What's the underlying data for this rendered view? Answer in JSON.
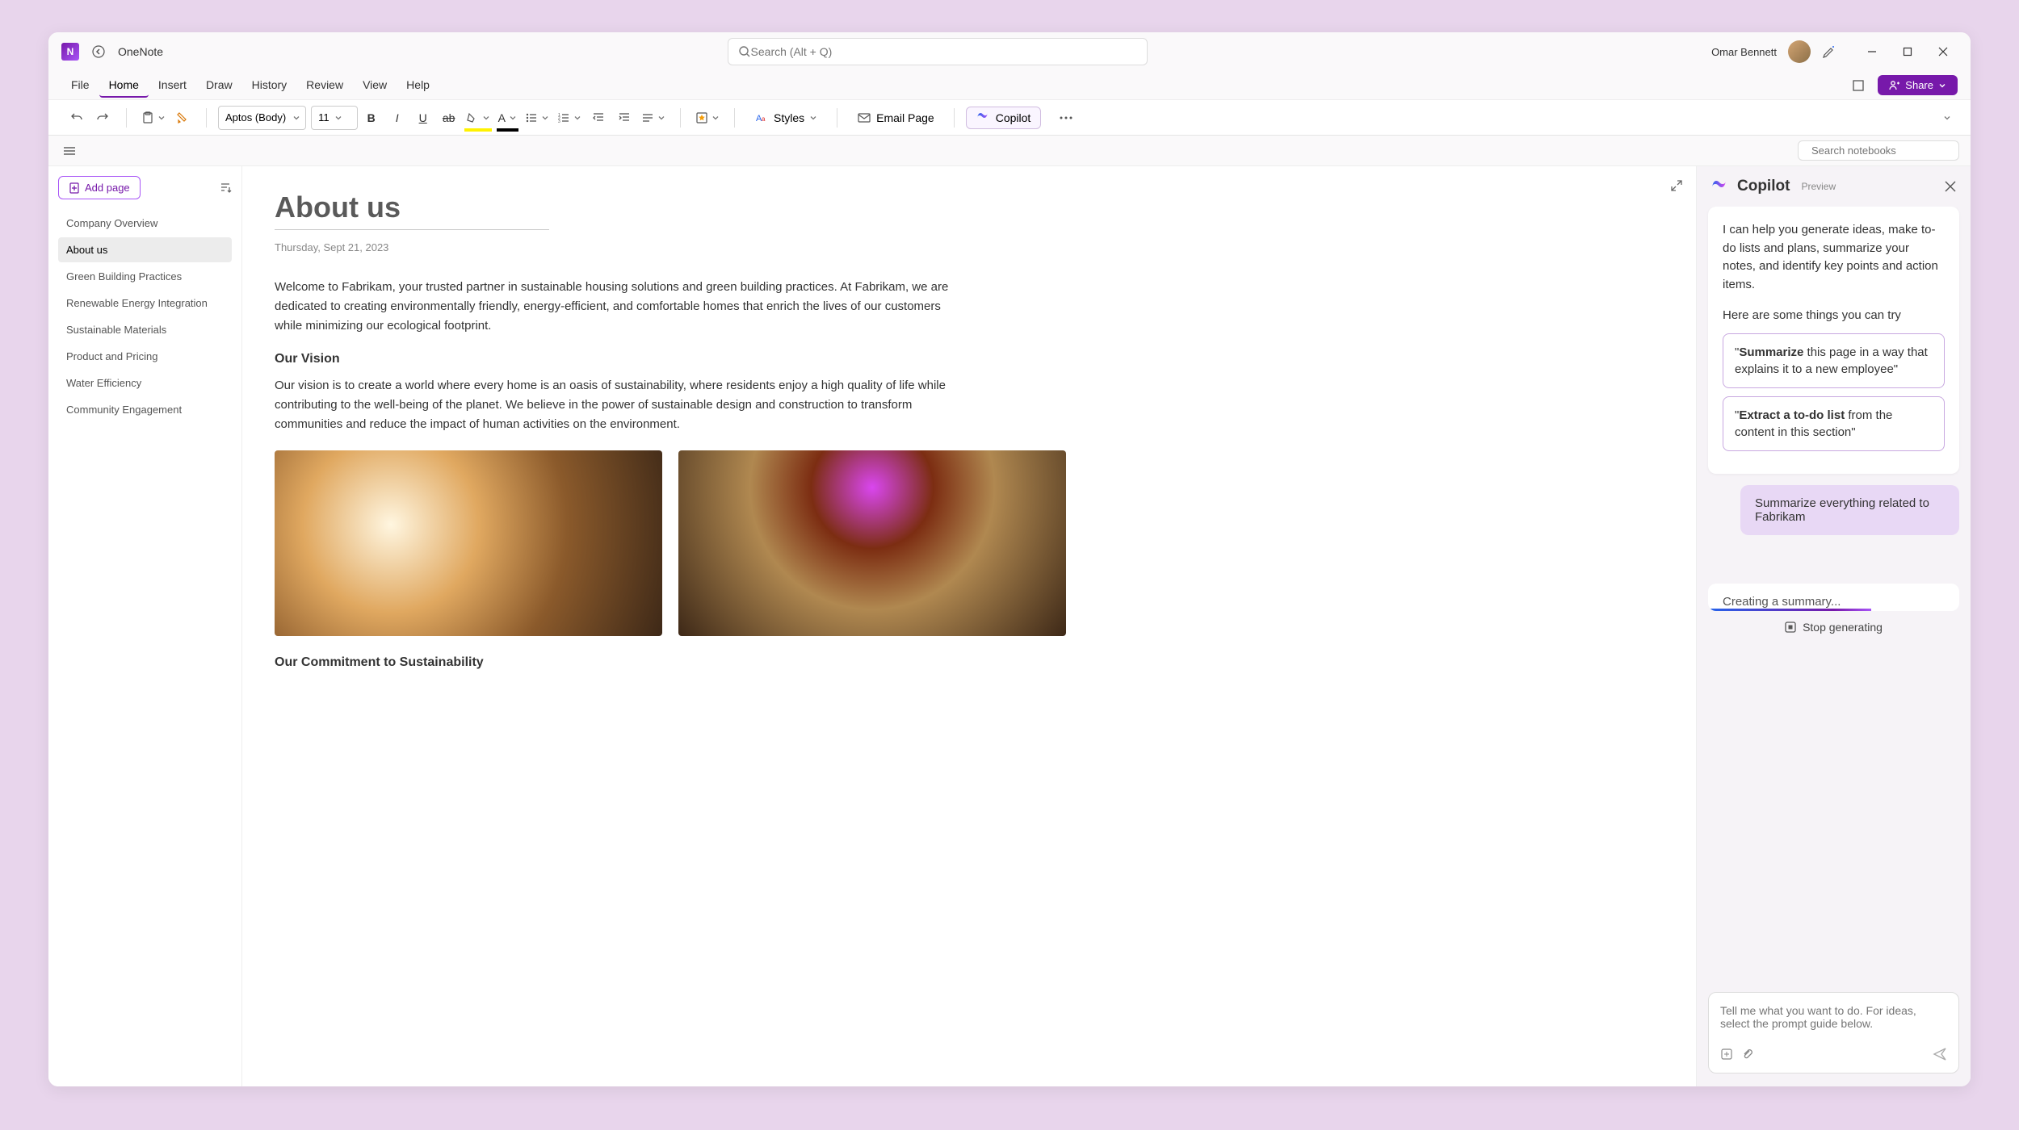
{
  "titlebar": {
    "app_name": "OneNote",
    "search_placeholder": "Search (Alt + Q)",
    "user_name": "Omar Bennett"
  },
  "menus": [
    "File",
    "Home",
    "Insert",
    "Draw",
    "History",
    "Review",
    "View",
    "Help"
  ],
  "active_menu": "Home",
  "share_label": "Share",
  "ribbon": {
    "font_name": "Aptos (Body)",
    "font_size": "11",
    "styles_label": "Styles",
    "email_label": "Email Page",
    "copilot_label": "Copilot"
  },
  "notebook_search_placeholder": "Search notebooks",
  "pagelist": {
    "add_label": "Add page",
    "items": [
      {
        "label": "Company Overview"
      },
      {
        "label": "About us",
        "active": true
      },
      {
        "label": "Green Building Practices"
      },
      {
        "label": "Renewable Energy Integration"
      },
      {
        "label": "Sustainable Materials"
      },
      {
        "label": "Product and Pricing"
      },
      {
        "label": "Water Efficiency"
      },
      {
        "label": "Community Engagement"
      }
    ]
  },
  "page": {
    "title": "About us",
    "date": "Thursday, Sept 21, 2023",
    "para1": "Welcome to Fabrikam, your trusted partner in sustainable housing solutions and green building practices. At Fabrikam, we are dedicated to creating environmentally friendly, energy-efficient, and comfortable homes that enrich the lives of our customers while minimizing our ecological footprint.",
    "heading1": "Our Vision",
    "para2": "Our vision is to create a world where every home is an oasis of sustainability, where residents enjoy a high quality of life while contributing to the well-being of the planet. We believe in the power of sustainable design and construction to transform communities and reduce the impact of human activities on the environment.",
    "heading2": "Our Commitment to Sustainability"
  },
  "copilot": {
    "title": "Copilot",
    "preview": "Preview",
    "intro": "I can help you generate ideas, make to-do lists and plans, summarize your notes, and identify key points and action items.",
    "try_label": "Here are some things you can try",
    "suggestion1_bold": "Summarize",
    "suggestion1_rest": " this page in a way that explains it to a new employee\"",
    "suggestion2_bold": "Extract a to-do list",
    "suggestion2_rest": " from the content in this section\"",
    "user_message": "Summarize everything related to Fabrikam",
    "status": "Creating a summary...",
    "stop_label": "Stop generating",
    "input_placeholder": "Tell me what you want to do. For ideas, select the prompt guide below."
  }
}
